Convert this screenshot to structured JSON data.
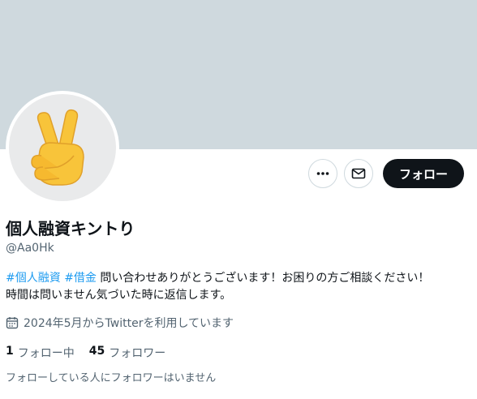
{
  "colors": {
    "banner": "#cfd9de",
    "link": "#1d9bf0",
    "primary_text": "#0f1419",
    "secondary_text": "#536471",
    "follow_button": "#0f1419"
  },
  "profile": {
    "avatar_icon": "victory-hand-emoji",
    "display_name": "個人融資キントり",
    "handle": "@Aa0Hk",
    "bio": {
      "tag1": "#個人融資",
      "tag2": "#借金",
      "text_line1": "問い合わせありがとうございます！お困りの方ご相談ください！",
      "text_line2": "時間は問いません気づいた時に返信します。"
    },
    "joined_icon": "calendar-icon",
    "joined": "2024年5月からTwitterを利用しています",
    "following_count": "1",
    "following_label": "フォロー中",
    "followers_count": "45",
    "followers_label": "フォロワー",
    "followers_you_know": "フォローしている人にフォロワーはいません"
  },
  "actions": {
    "more_icon": "more-icon",
    "message_icon": "mail-icon",
    "follow_label": "フォロー"
  }
}
